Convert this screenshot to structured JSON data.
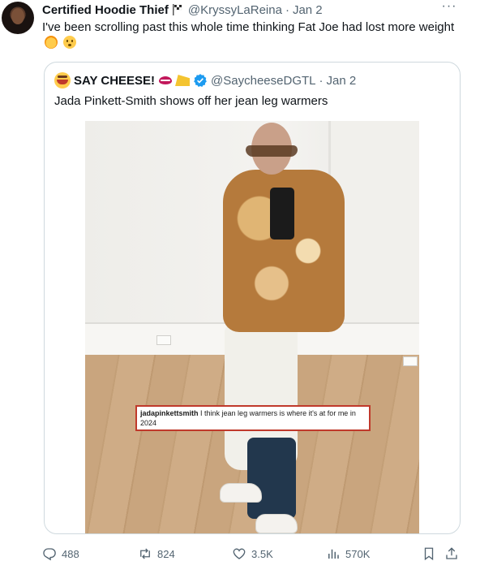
{
  "tweet": {
    "author_name": "Certified Hoodie Thief",
    "author_handle": "@KryssyLaReina",
    "separator": "·",
    "date": "Jan 2",
    "text": "I've been scrolling past this whole time thinking Fat Joe had lost more weight"
  },
  "quoted_tweet": {
    "author_name": "SAY CHEESE!",
    "author_handle": "@SaycheeseDGTL",
    "separator": "·",
    "date": "Jan 2",
    "text": "Jada Pinkett-Smith shows off her jean leg warmers",
    "image_caption_user": "jadapinkettsmith",
    "image_caption_text": "I think jean leg warmers is where it's at for me in 2024"
  },
  "actions": {
    "replies": "488",
    "reposts": "824",
    "likes": "3.5K",
    "views": "570K"
  },
  "colors": {
    "text_primary": "#0f1419",
    "text_secondary": "#536471",
    "border": "#cfd9de",
    "verified": "#1d9bf0"
  },
  "icons": [
    "flag-icon",
    "more-icon",
    "hot-face-emoji",
    "hushed-face-emoji",
    "lips-icon",
    "cheese-icon",
    "verified-icon",
    "reply-icon",
    "repost-icon",
    "like-icon",
    "views-icon",
    "bookmark-icon",
    "share-icon"
  ]
}
